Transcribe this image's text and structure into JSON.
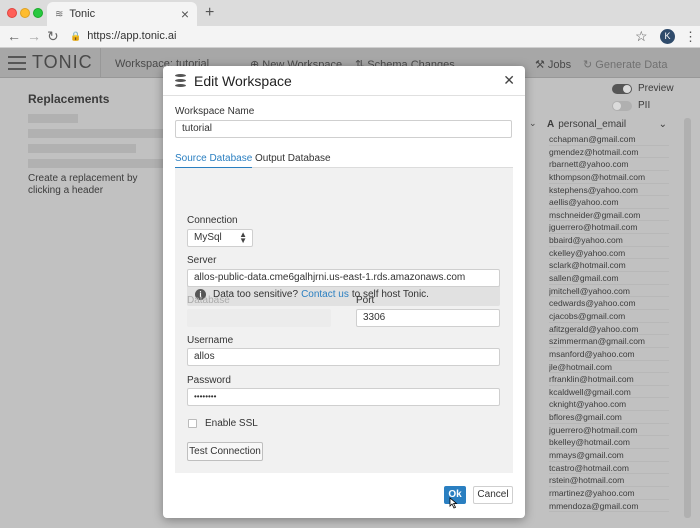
{
  "browser": {
    "tab_title": "Tonic",
    "url": "https://app.tonic.ai",
    "profile_initial": "K"
  },
  "app": {
    "logo_text": "TONIC",
    "workspace_label": "Workspace:",
    "workspace_value": "tutorial",
    "nav": {
      "new_workspace": "New Workspace",
      "schema_changes": "Schema Changes",
      "jobs": "Jobs",
      "generate_data": "Generate Data"
    }
  },
  "left_panel": {
    "title": "Replacements",
    "hint": "Create a replacement by clicking a header"
  },
  "right_panel": {
    "preview_label": "Preview",
    "pii_label": "PII",
    "column_header": "personal_email",
    "emails": [
      "cchapman@gmail.com",
      "gmendez@hotmail.com",
      "rbarnett@yahoo.com",
      "kthompson@hotmail.com",
      "kstephens@yahoo.com",
      "aellis@yahoo.com",
      "mschneider@gmail.com",
      "jguerrero@hotmail.com",
      "bbaird@yahoo.com",
      "ckelley@yahoo.com",
      "sclark@hotmail.com",
      "sallen@gmail.com",
      "jmitchell@yahoo.com",
      "cedwards@yahoo.com",
      "cjacobs@gmail.com",
      "afitzgerald@yahoo.com",
      "szimmerman@gmail.com",
      "msanford@yahoo.com",
      "jle@hotmail.com",
      "rfranklin@hotmail.com",
      "kcaldwell@gmail.com",
      "cknight@yahoo.com",
      "bflores@gmail.com",
      "jguerrero@hotmail.com",
      "bkelley@hotmail.com",
      "mmays@gmail.com",
      "tcastro@hotmail.com",
      "rstein@hotmail.com",
      "rmartinez@yahoo.com",
      "mmendoza@gmail.com"
    ]
  },
  "modal": {
    "title": "Edit Workspace",
    "workspace_name_label": "Workspace Name",
    "workspace_name_value": "tutorial",
    "tabs": [
      "Source Database",
      "Output Database"
    ],
    "info": {
      "prefix": "Data too sensitive?",
      "link": "Contact us",
      "suffix": "to self host Tonic."
    },
    "connection_label": "Connection",
    "connection_value": "MySql",
    "server_label": "Server",
    "server_value": "allos-public-data.cme6galhjrni.us-east-1.rds.amazonaws.com",
    "database_label": "Database",
    "database_value": "",
    "port_label": "Port",
    "port_value": "3306",
    "username_label": "Username",
    "username_value": "allos",
    "password_label": "Password",
    "password_value": "••••••••",
    "ssl_label": "Enable SSL",
    "ssl_checked": false,
    "test_connection_label": "Test Connection",
    "ok_label": "Ok",
    "cancel_label": "Cancel"
  },
  "colors": {
    "accent": "#2a7fc1",
    "app_header": "#bdbdbd",
    "overlay": "#5a5a5a"
  }
}
